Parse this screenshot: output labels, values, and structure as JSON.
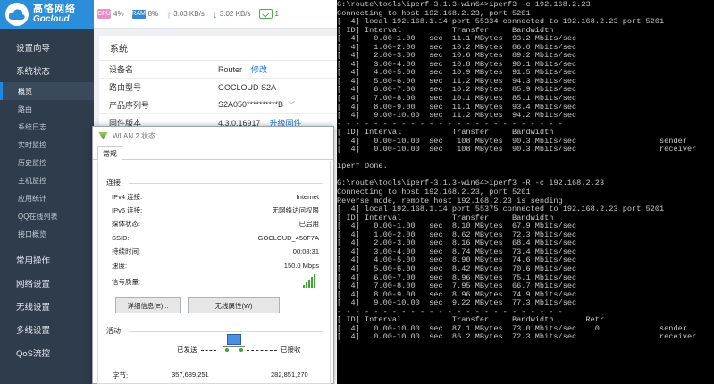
{
  "router": {
    "logo": {
      "cn": "高恪网络",
      "en": "Gocloud"
    },
    "status": {
      "cpu_icon": "CPU",
      "cpu": "4%",
      "ram_icon": "RAM",
      "ram": "8%",
      "up": "3.03 KB/s",
      "down": "3.02 KB/s",
      "clients": "1"
    },
    "sidebar": {
      "sections_top": [
        "设置向导",
        "系统状态"
      ],
      "sub_items": [
        "概览",
        "路由",
        "系统日志",
        "实时监控",
        "历史监控",
        "主机监控",
        "应用统计",
        "QQ在线列表",
        "接口概览"
      ],
      "sections_bottom": [
        "常用操作",
        "网络设置",
        "无线设置",
        "多线设置",
        "QoS流控"
      ]
    },
    "system": {
      "title": "系统",
      "rows": [
        {
          "key": "设备名",
          "value": "Router",
          "link": "修改"
        },
        {
          "key": "路由型号",
          "value": "GOCLOUD S2A",
          "link": ""
        },
        {
          "key": "产品序列号",
          "value": "S2A050**********B",
          "link": ""
        },
        {
          "key": "固件版本",
          "value": "4.3.0.16917",
          "link": "升级固件"
        }
      ]
    }
  },
  "wlan": {
    "title": "WLAN 2 状态",
    "tab": "常规",
    "connection_group": "连接",
    "rows": [
      {
        "label": "IPv4 连接:",
        "value": "Internet"
      },
      {
        "label": "IPv6 连接:",
        "value": "无网络访问权限"
      },
      {
        "label": "媒体状态:",
        "value": "已启用"
      },
      {
        "label": "SSID:",
        "value": "GOCLOUD_450F7A"
      },
      {
        "label": "持续时间:",
        "value": "00:08:31"
      },
      {
        "label": "速度:",
        "value": "150.0 Mbps"
      }
    ],
    "signal_label": "信号质量:",
    "signal_bars": 5,
    "details_button": "详细信息(E)...",
    "wireless_button": "无线属性(W)",
    "activity_group": "活动",
    "sent_label": "已发送",
    "received_label": "已接收",
    "bytes_label": "字节:",
    "bytes_sent": "357,689,251",
    "bytes_received": "282,851,270"
  },
  "terminal": {
    "lines": [
      "G:\\route\\tools\\iperf-3.1.3-win64>iperf3 -c 192.168.2.23",
      "Connecting to host 192.168.2.23, port 5201",
      "[  4] local 192.168.1.14 port 55334 connected to 192.168.2.23 port 5201",
      "[ ID] Interval           Transfer     Bandwidth",
      "[  4]   0.00-1.00   sec  11.1 MBytes  93.2 Mbits/sec",
      "[  4]   1.00-2.00   sec  10.2 MBytes  86.0 Mbits/sec",
      "[  4]   2.00-3.00   sec  10.6 MBytes  89.2 Mbits/sec",
      "[  4]   3.00-4.00   sec  10.8 MBytes  90.1 Mbits/sec",
      "[  4]   4.00-5.00   sec  10.9 MBytes  91.5 Mbits/sec",
      "[  4]   5.00-6.00   sec  11.2 MBytes  94.3 Mbits/sec",
      "[  4]   6.00-7.00   sec  10.2 MBytes  85.9 Mbits/sec",
      "[  4]   7.00-8.00   sec  10.1 MBytes  85.1 Mbits/sec",
      "[  4]   8.00-9.00   sec  11.1 MBytes  93.4 Mbits/sec",
      "[  4]   9.00-10.00  sec  11.2 MBytes  94.2 Mbits/sec",
      "- - - - - - - - - - - - - - - - - - - - - - - - -",
      "[ ID] Interval           Transfer     Bandwidth",
      "[  4]   0.00-10.00  sec   108 MBytes  90.3 Mbits/sec                  sender",
      "[  4]   0.00-10.00  sec   108 MBytes  90.3 Mbits/sec                  receiver",
      "",
      "iperf Done.",
      "",
      "G:\\route\\tools\\iperf-3.1.3-win64>iperf3 -R -c 192.168.2.23",
      "Connecting to host 192.168.2.23, port 5201",
      "Reverse mode, remote host 192.168.2.23 is sending",
      "[  4] local 192.168.1.14 port 55375 connected to 192.168.2.23 port 5201",
      "[ ID] Interval           Transfer     Bandwidth",
      "[  4]   0.00-1.00   sec  8.10 MBytes  67.9 Mbits/sec",
      "[  4]   1.00-2.00   sec  8.62 MBytes  72.3 Mbits/sec",
      "[  4]   2.00-3.00   sec  8.16 MBytes  68.4 Mbits/sec",
      "[  4]   3.00-4.00   sec  8.74 MBytes  73.4 Mbits/sec",
      "[  4]   4.00-5.00   sec  8.90 MBytes  74.6 Mbits/sec",
      "[  4]   5.00-6.00   sec  8.42 MBytes  70.6 Mbits/sec",
      "[  4]   6.00-7.00   sec  8.96 MBytes  75.1 Mbits/sec",
      "[  4]   7.00-8.00   sec  7.95 MBytes  66.7 Mbits/sec",
      "[  4]   8.00-9.00   sec  8.96 MBytes  74.9 Mbits/sec",
      "[  4]   9.00-10.00  sec  9.22 MBytes  77.3 Mbits/sec",
      "- - - - - - - - - - - - - - - - - - - - - - - - -",
      "[ ID] Interval           Transfer     Bandwidth       Retr",
      "[  4]   0.00-10.00  sec  87.1 MBytes  73.0 Mbits/sec    0             sender",
      "[  4]   0.00-10.00  sec  86.2 MBytes  72.3 Mbits/sec                  receiver"
    ]
  }
}
